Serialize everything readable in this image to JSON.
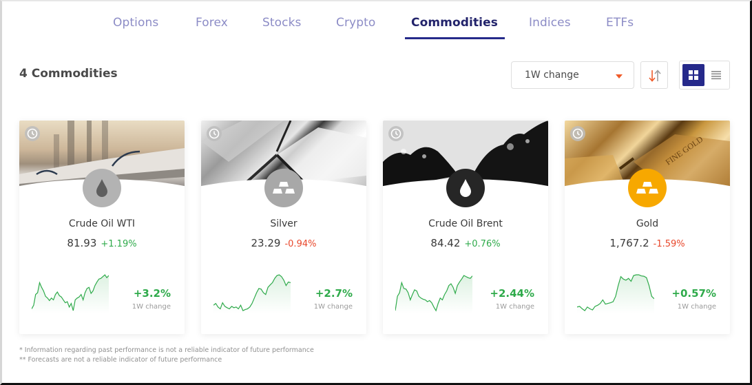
{
  "tabs": [
    {
      "label": "Options",
      "active": false
    },
    {
      "label": "Forex",
      "active": false
    },
    {
      "label": "Stocks",
      "active": false
    },
    {
      "label": "Crypto",
      "active": false
    },
    {
      "label": "Commodities",
      "active": true
    },
    {
      "label": "Indices",
      "active": false
    },
    {
      "label": "ETFs",
      "active": false
    }
  ],
  "header": {
    "count_title": "4 Commodities",
    "sort_select": {
      "value": "1W change"
    },
    "sort_direction_icon": "sort-arrows-icon",
    "view_modes": [
      {
        "name": "grid-view",
        "icon": "grid-icon",
        "active": true
      },
      {
        "name": "list-view",
        "icon": "list-icon",
        "active": false
      }
    ]
  },
  "colors": {
    "accent": "#25298a",
    "tab_inactive": "#8c8cc6",
    "positive": "#2eaa4a",
    "negative": "#e8472b",
    "gold_badge": "#f7a800",
    "silver_badge": "#a8a8a8",
    "wti_badge": "#b3b3b3",
    "brent_badge": "#262626"
  },
  "cards": [
    {
      "name": "Crude Oil WTI",
      "price": "81.93",
      "daily_change": "+1.19%",
      "daily_direction": "up",
      "weekly_change": "+3.2%",
      "weekly_label": "1W change",
      "icon": "oil-drop-icon",
      "sparkline": [
        0.05,
        0.15,
        0.45,
        0.5,
        0.78,
        0.65,
        0.55,
        0.4,
        0.35,
        0.28,
        0.35,
        0.3,
        0.45,
        0.52,
        0.42,
        0.38,
        0.3,
        0.22,
        0.25,
        0.1,
        0.2,
        0.0,
        0.3,
        0.35,
        0.38,
        0.45,
        0.3,
        0.5,
        0.62,
        0.65,
        0.48,
        0.55,
        0.7,
        0.8,
        0.88,
        0.9,
        0.95,
        1.0,
        0.92,
        0.98
      ]
    },
    {
      "name": "Silver",
      "price": "23.29",
      "daily_change": "-0.94%",
      "daily_direction": "down",
      "weekly_change": "+2.7%",
      "weekly_label": "1W change",
      "icon": "bullion-icon",
      "sparkline": [
        0.15,
        0.2,
        0.1,
        0.05,
        0.22,
        0.12,
        0.08,
        0.05,
        0.12,
        0.08,
        0.1,
        0.05,
        0.15,
        0.0,
        0.03,
        0.05,
        0.1,
        0.2,
        0.35,
        0.5,
        0.62,
        0.6,
        0.5,
        0.45,
        0.65,
        0.72,
        0.78,
        0.9,
        0.98,
        1.0,
        0.95,
        0.85,
        0.7,
        0.8,
        0.78
      ]
    },
    {
      "name": "Crude Oil Brent",
      "price": "84.42",
      "daily_change": "+0.76%",
      "daily_direction": "up",
      "weekly_change": "+2.44%",
      "weekly_label": "1W change",
      "icon": "oil-drop-icon",
      "sparkline": [
        0.0,
        0.4,
        0.5,
        0.78,
        0.62,
        0.6,
        0.5,
        0.3,
        0.45,
        0.58,
        0.55,
        0.4,
        0.35,
        0.32,
        0.3,
        0.25,
        0.28,
        0.22,
        0.1,
        0.0,
        0.2,
        0.35,
        0.3,
        0.45,
        0.55,
        0.7,
        0.75,
        0.65,
        0.48,
        0.7,
        0.8,
        0.88,
        0.98,
        0.95,
        0.92,
        0.9,
        0.97
      ]
    },
    {
      "name": "Gold",
      "price": "1,767.2",
      "daily_change": "-1.59%",
      "daily_direction": "down",
      "weekly_change": "+0.57%",
      "weekly_label": "1W change",
      "icon": "bullion-icon",
      "sparkline": [
        0.1,
        0.12,
        0.05,
        0.0,
        0.1,
        0.05,
        0.02,
        0.12,
        0.15,
        0.2,
        0.3,
        0.18,
        0.2,
        0.22,
        0.25,
        0.4,
        0.7,
        0.95,
        0.88,
        0.85,
        0.9,
        0.82,
        0.98,
        1.0,
        1.0,
        0.97,
        0.96,
        0.92,
        0.7,
        0.4,
        0.33
      ]
    }
  ],
  "footnotes": [
    "* Information regarding past performance is not a reliable indicator of future performance",
    "** Forecasts are not a reliable indicator of future performance"
  ]
}
